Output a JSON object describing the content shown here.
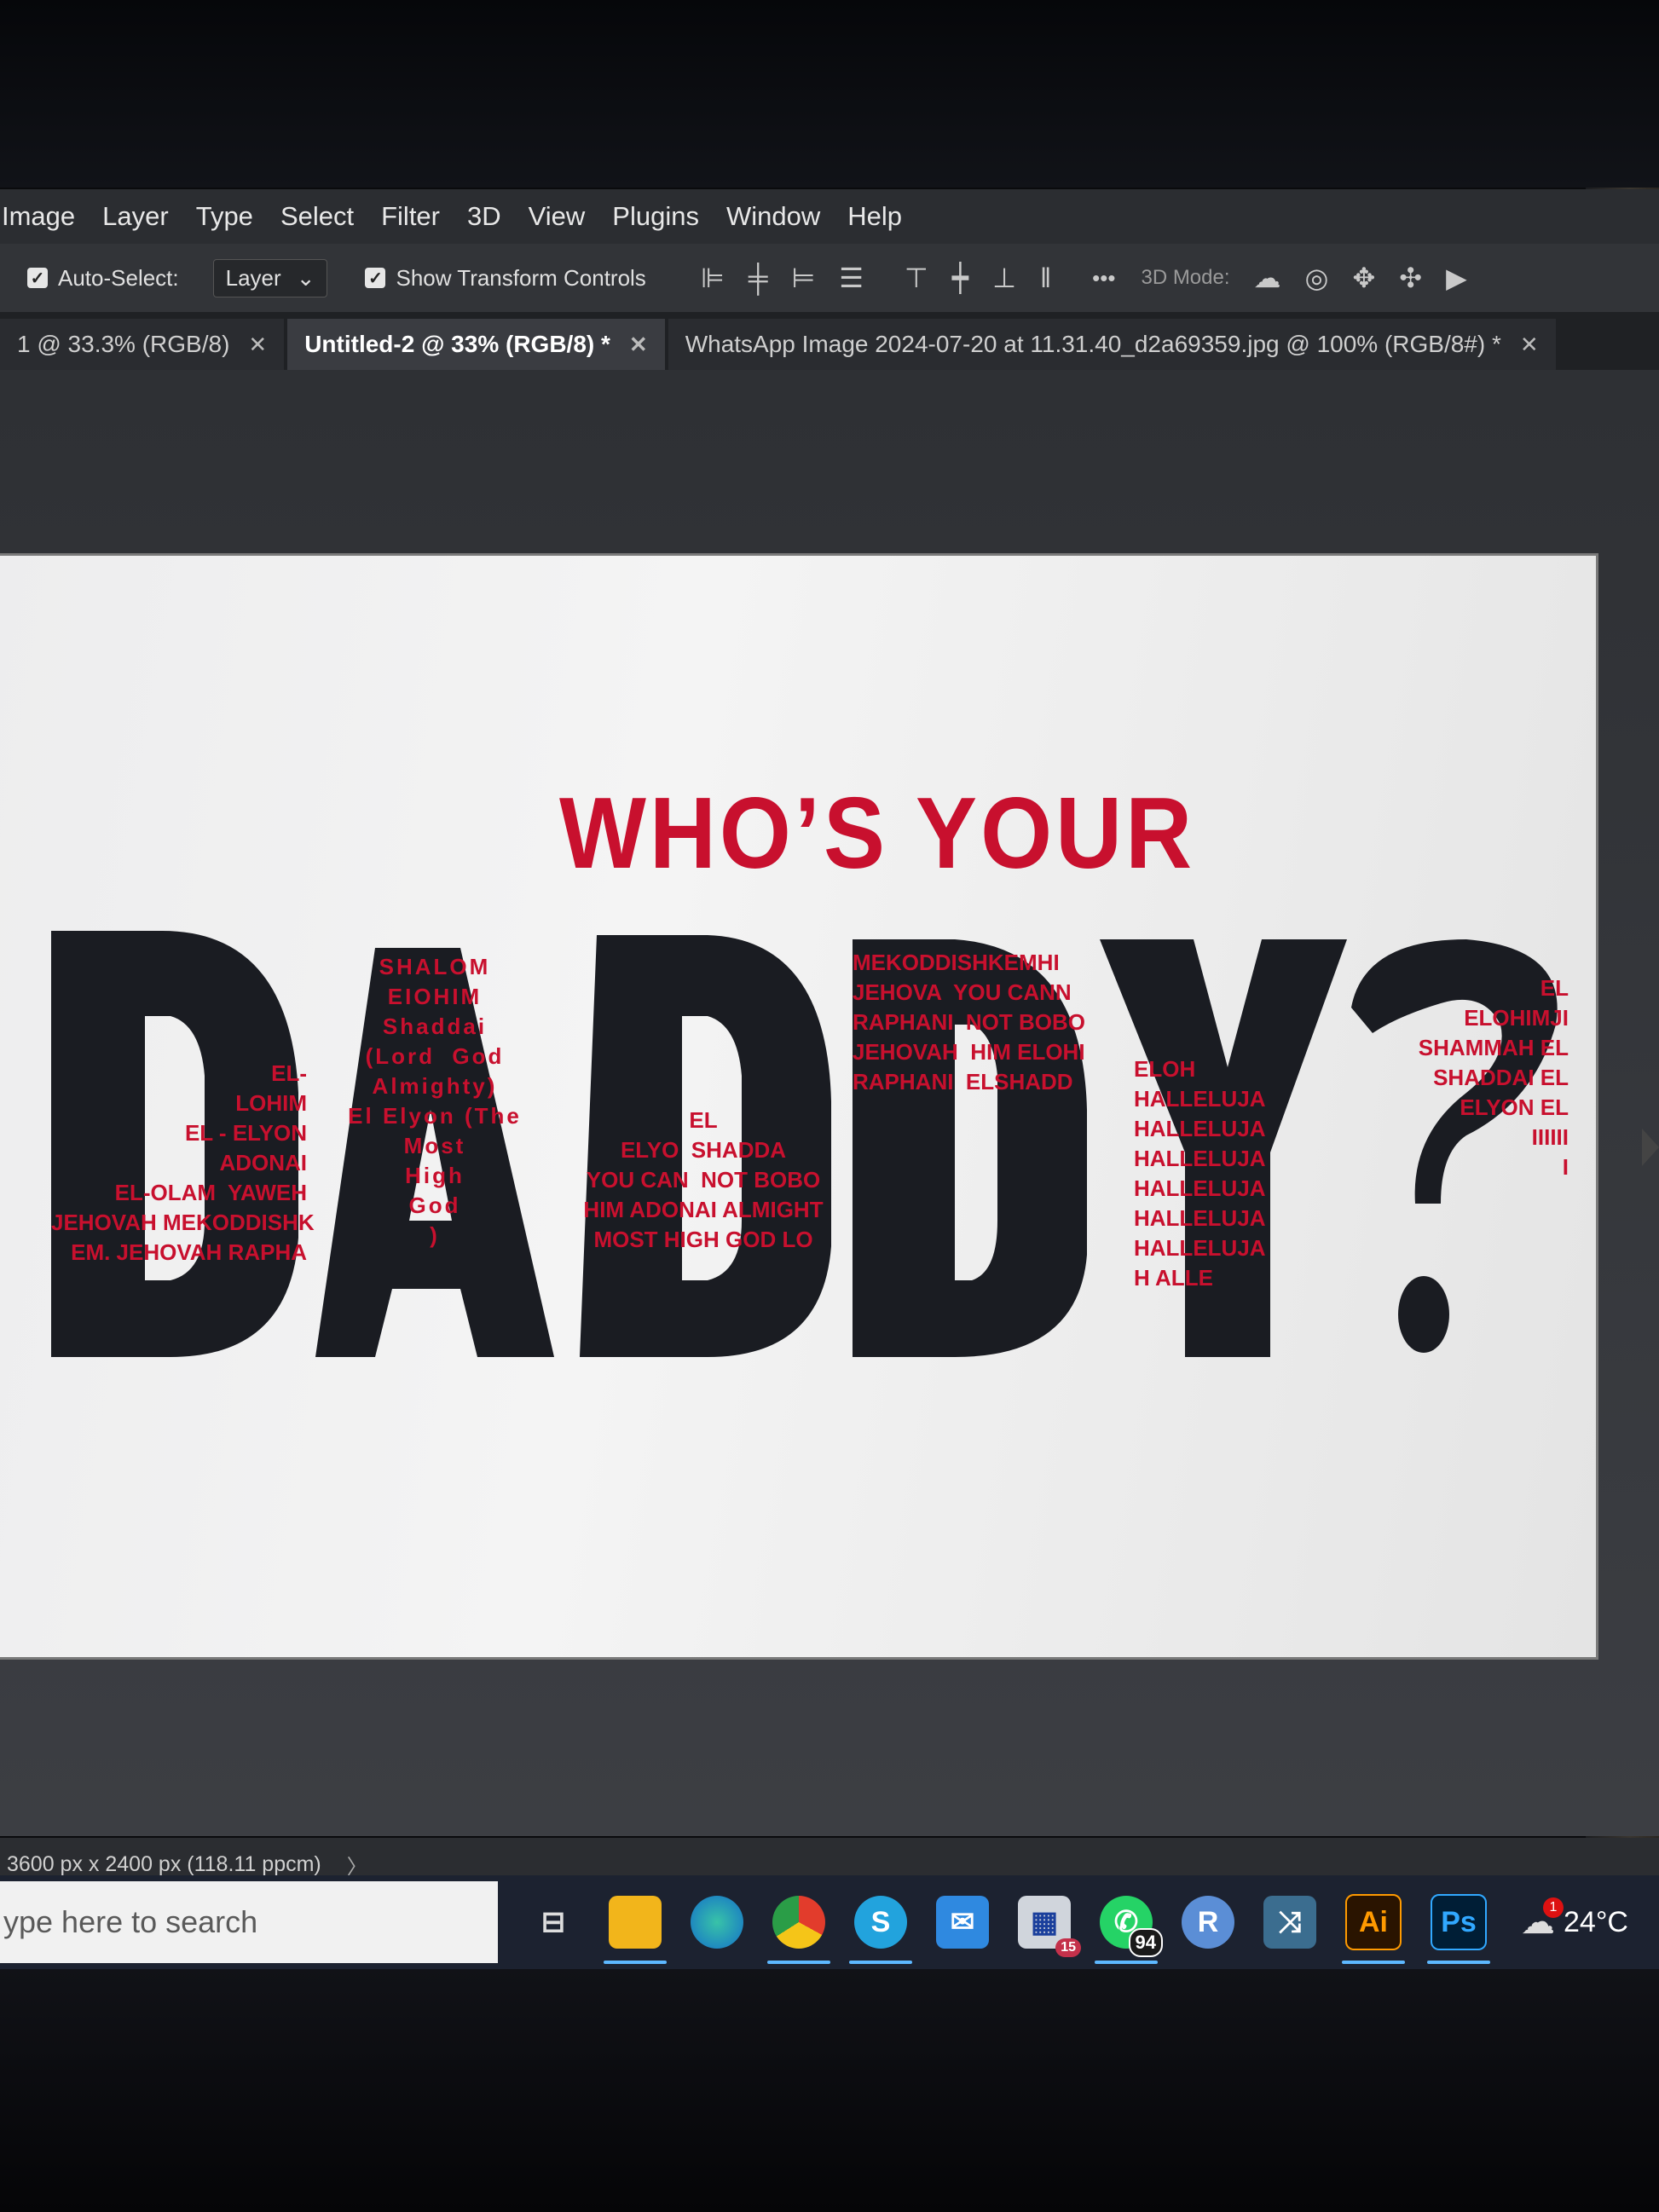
{
  "menu": [
    "Image",
    "Layer",
    "Type",
    "Select",
    "Filter",
    "3D",
    "View",
    "Plugins",
    "Window",
    "Help"
  ],
  "options": {
    "auto_select_label": "Auto-Select:",
    "auto_select_value": "Layer",
    "transform_label": "Show Transform Controls",
    "more_label": "•••",
    "mode_label": "3D Mode:"
  },
  "tabs": [
    {
      "label": "1 @ 33.3% (RGB/8)",
      "active": false
    },
    {
      "label": "Untitled-2 @ 33% (RGB/8) *",
      "active": true
    },
    {
      "label": "WhatsApp Image 2024-07-20 at 11.31.40_d2a69359.jpg @ 100% (RGB/8#) *",
      "active": false
    }
  ],
  "artwork": {
    "headline": "WHO’S YOUR",
    "big_word": "DADDY?",
    "clusters": [
      "EL-\nLOHIM\nEL - ELYON\nADONAI\nEL-OLAM  YAWEH\nJEHOVAH MEKODDISHK\nEM. JEHOVAH RAPHA",
      "SHALOM\nEIOHIM\nShaddai\n(Lord  God\nAlmighty)\nEl Elyon (The\nMost\nHigh\nGod\n)",
      "EL\nELYO  SHADDA\nYOU CAN  NOT BOBO\nHIM ADONAI ALMIGHT\nMOST HIGH GOD LO",
      "MEKODDISHKEMHI\nJEHOVA  YOU CANN\nRAPHANI  NOT BOBO\nJEHOVAH  HIM ELOHI\nRAPHANI  ELSHADD",
      "ELOH\nHALLELUJA\nHALLELUJA\nHALLELUJA\nHALLELUJA\nHALLELUJA\nHALLELUJA\nH ALLE",
      "EL\nELOHIMJI\nSHAMMAH EL\nSHADDAI EL\nELYON EL\nIIIIII\nI"
    ]
  },
  "status": {
    "doc_size": "3600 px x 2400 px (118.11 ppcm)",
    "arrow": "〉"
  },
  "taskbar": {
    "search_placeholder": "ype here to search",
    "whatsapp_count": "94",
    "mail_badge": "15",
    "weather_alert": "1",
    "temperature": "24°C"
  },
  "colors": {
    "accent_red": "#c8102e",
    "letter_black": "#1a1c22"
  }
}
